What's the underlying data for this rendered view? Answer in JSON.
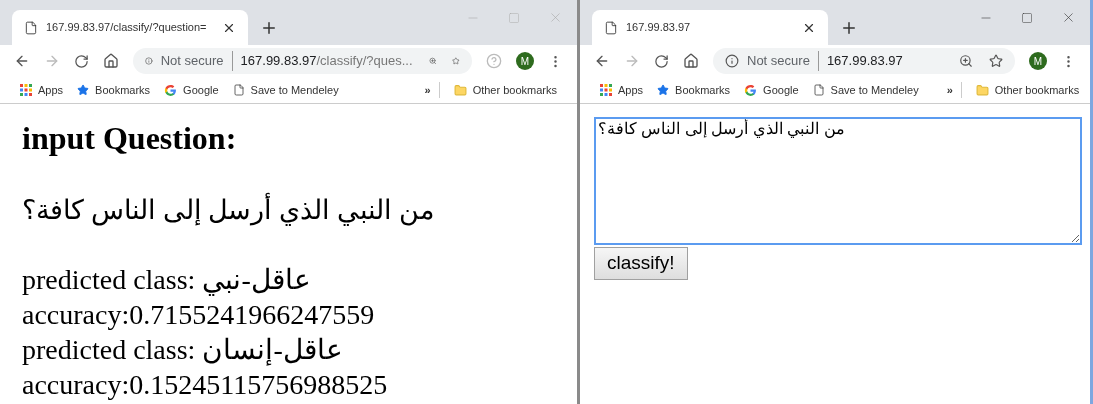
{
  "windows": [
    {
      "active": false,
      "tab": {
        "title": "167.99.83.97/classify/?question="
      },
      "address": {
        "security": "Not secure",
        "host": "167.99.83.97",
        "path": "/classify/?ques..."
      },
      "help": true,
      "avatar": "M",
      "bookmarks": [
        "Apps",
        "Bookmarks",
        "Google",
        "Save to Mendeley"
      ],
      "overflow": "»",
      "other_bookmarks": "Other bookmarks",
      "page": {
        "kind": "result",
        "heading": "input Question:",
        "question": "من النبي الذي أرسل إلى الناس كافة؟",
        "lines": [
          "predicted class: عاقل-نبي",
          "accuracy:0.7155241966247559",
          "predicted class: عاقل-إنسان",
          "accuracy:0.15245115756988525"
        ]
      }
    },
    {
      "active": true,
      "tab": {
        "title": "167.99.83.97"
      },
      "address": {
        "security": "Not secure",
        "host": "167.99.83.97"
      },
      "help": false,
      "avatar": "M",
      "bookmarks": [
        "Apps",
        "Bookmarks",
        "Google",
        "Save to Mendeley"
      ],
      "overflow": "»",
      "other_bookmarks": "Other bookmarks",
      "page": {
        "kind": "form",
        "textarea": {
          "value": "من النبي الذي أرسل إلى الناس كافة؟",
          "focused": true
        },
        "button": "classify!"
      }
    }
  ]
}
